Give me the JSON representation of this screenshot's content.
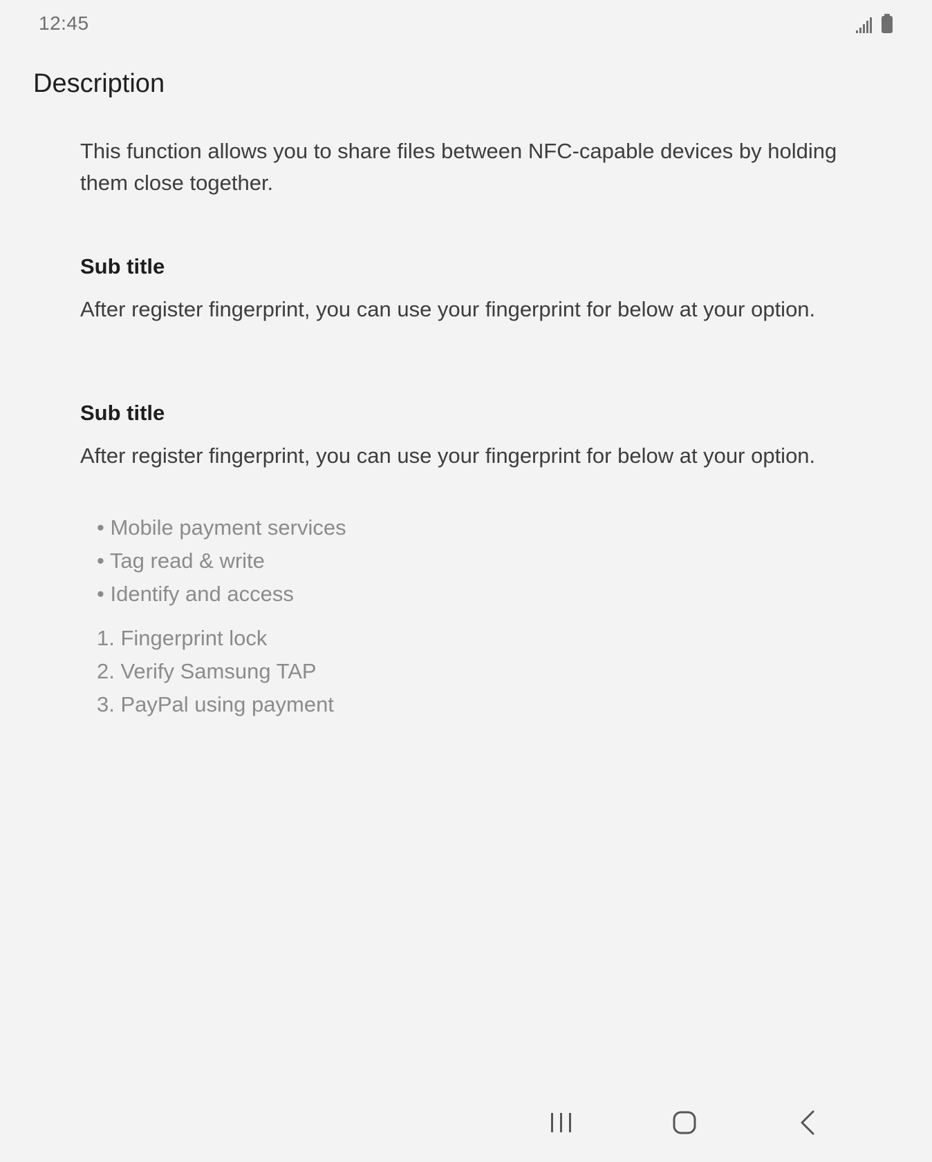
{
  "status_bar": {
    "time": "12:45",
    "signal_icon": "signal-icon",
    "battery_icon": "battery-icon"
  },
  "page": {
    "title": "Description",
    "intro": "This function allows you to share files between NFC-capable devices by holding them close together.",
    "sections": [
      {
        "subtitle": "Sub title",
        "body": "After register fingerprint, you can use your fingerprint for below at your option."
      },
      {
        "subtitle": "Sub title",
        "body": "After register fingerprint, you can use your fingerprint for below at your option."
      }
    ],
    "bullet_list": [
      "Mobile payment services",
      "Tag read & write",
      "Identify and access"
    ],
    "numbered_list": [
      "1. Fingerprint lock",
      "2. Verify Samsung TAP",
      "3. PayPal using payment"
    ]
  },
  "nav_bar": {
    "recents_icon": "recents-icon",
    "home_icon": "home-icon",
    "back_icon": "back-icon"
  },
  "colors": {
    "background": "#f3f3f3",
    "title_text": "#202020",
    "body_text": "#3d3d3d",
    "list_text": "#8b8b8b",
    "icon_gray": "#6f6f6f"
  }
}
